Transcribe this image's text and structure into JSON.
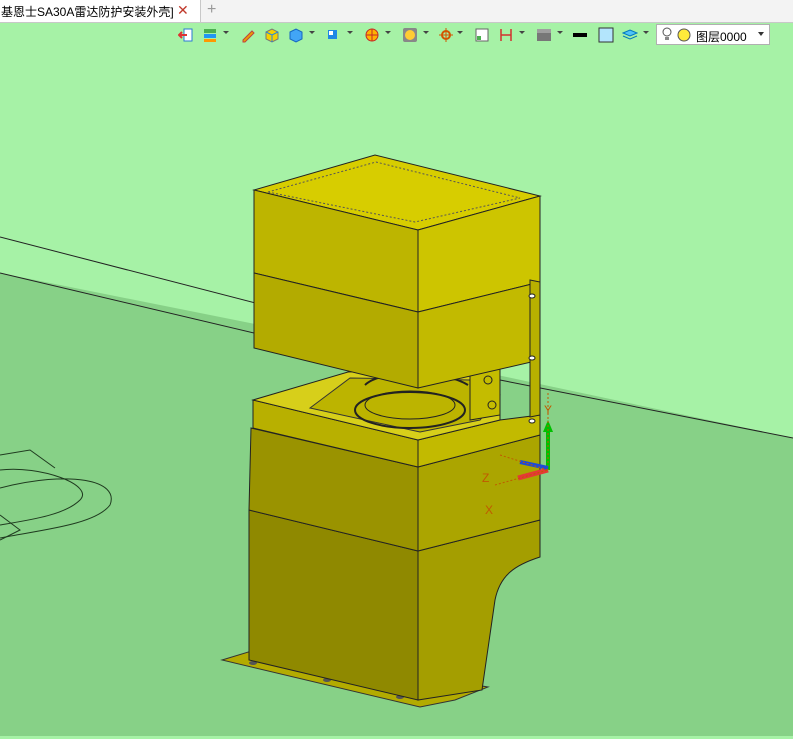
{
  "tab": {
    "title": "基恩士SA30A雷达防护安装外壳]",
    "close_glyph": "✕",
    "new_glyph": "+"
  },
  "toolbar": {
    "layer_label": "图层0000"
  },
  "axes": {
    "x": "X",
    "y": "Y",
    "z": "Z"
  },
  "colors": {
    "background": "#a6f2a6",
    "floor": "#87d187",
    "housing_light": "#d4cc00",
    "housing_mid": "#a8a200",
    "housing_dark": "#8c8800"
  }
}
